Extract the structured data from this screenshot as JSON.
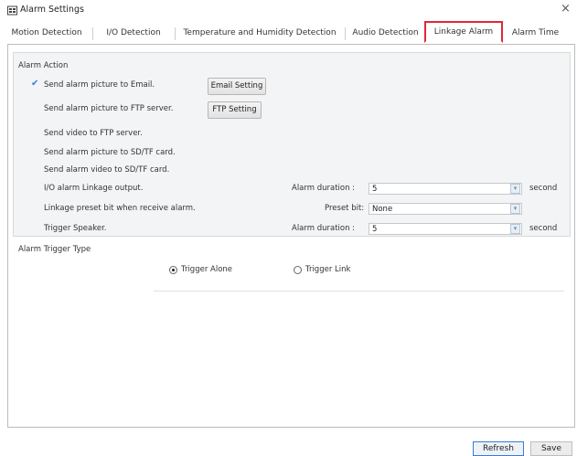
{
  "window": {
    "title": "Alarm Settings",
    "close_glyph": "×"
  },
  "tabs": [
    {
      "label": "Motion Detection",
      "active": false
    },
    {
      "label": "I/O Detection",
      "active": false
    },
    {
      "label": "Temperature and Humidity Detection",
      "active": false
    },
    {
      "label": "Audio Detection",
      "active": false
    },
    {
      "label": "Linkage Alarm",
      "active": true
    },
    {
      "label": "Alarm Time",
      "active": false
    }
  ],
  "alarm_action": {
    "heading": "Alarm Action",
    "rows": [
      {
        "label": "Send alarm picture to Email.",
        "checked": true,
        "button": "Email Setting"
      },
      {
        "label": "Send alarm picture to FTP server.",
        "checked": false,
        "button": "FTP Setting"
      },
      {
        "label": "Send video to FTP server.",
        "checked": false
      },
      {
        "label": "Send alarm picture to SD/TF card.",
        "checked": false
      },
      {
        "label": "Send alarm video to SD/TF card.",
        "checked": false
      },
      {
        "label": "I/O alarm Linkage output.",
        "checked": false,
        "field_label": "Alarm duration :",
        "value": "5",
        "unit": "second"
      },
      {
        "label": "Linkage preset bit when receive alarm.",
        "checked": false,
        "field_label": "Preset bit:",
        "value": "None",
        "unit": ""
      },
      {
        "label": "Trigger Speaker.",
        "checked": false,
        "field_label": "Alarm duration :",
        "value": "5",
        "unit": "second"
      }
    ]
  },
  "trigger_type": {
    "heading": "Alarm Trigger Type",
    "options": [
      {
        "label": "Trigger Alone",
        "selected": true
      },
      {
        "label": "Trigger Link",
        "selected": false
      }
    ]
  },
  "footer": {
    "refresh_label": "Refresh",
    "save_label": "Save"
  },
  "colors": {
    "active_tab_border": "#e0263a",
    "check": "#2f84d8"
  }
}
